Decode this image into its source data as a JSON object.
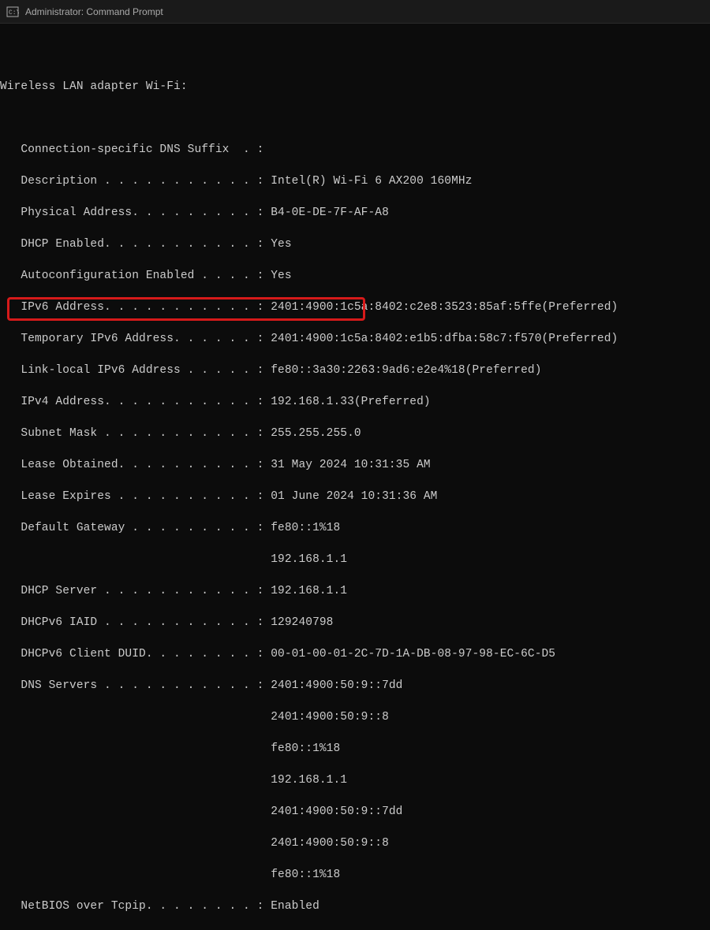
{
  "window": {
    "title": "Administrator: Command Prompt"
  },
  "terminal": {
    "lines": [
      "",
      "Wireless LAN adapter Wi-Fi:",
      "",
      "   Connection-specific DNS Suffix  . :",
      "   Description . . . . . . . . . . . : Intel(R) Wi-Fi 6 AX200 160MHz",
      "   Physical Address. . . . . . . . . : B4-0E-DE-7F-AF-A8",
      "   DHCP Enabled. . . . . . . . . . . : Yes",
      "   Autoconfiguration Enabled . . . . : Yes",
      "   IPv6 Address. . . . . . . . . . . : 2401:4900:1c5a:8402:c2e8:3523:85af:5ffe(Preferred)",
      "   Temporary IPv6 Address. . . . . . : 2401:4900:1c5a:8402:e1b5:dfba:58c7:f570(Preferred)",
      "   Link-local IPv6 Address . . . . . : fe80::3a30:2263:9ad6:e2e4%18(Preferred)",
      "   IPv4 Address. . . . . . . . . . . : 192.168.1.33(Preferred)",
      "   Subnet Mask . . . . . . . . . . . : 255.255.255.0",
      "   Lease Obtained. . . . . . . . . . : 31 May 2024 10:31:35 AM",
      "   Lease Expires . . . . . . . . . . : 01 June 2024 10:31:36 AM",
      "   Default Gateway . . . . . . . . . : fe80::1%18",
      "                                       192.168.1.1",
      "   DHCP Server . . . . . . . . . . . : 192.168.1.1",
      "   DHCPv6 IAID . . . . . . . . . . . : 129240798",
      "   DHCPv6 Client DUID. . . . . . . . : 00-01-00-01-2C-7D-1A-DB-08-97-98-EC-6C-D5",
      "   DNS Servers . . . . . . . . . . . : 2401:4900:50:9::7dd",
      "                                       2401:4900:50:9::8",
      "                                       fe80::1%18",
      "                                       192.168.1.1",
      "                                       2401:4900:50:9::7dd",
      "                                       2401:4900:50:9::8",
      "                                       fe80::1%18",
      "   NetBIOS over Tcpip. . . . . . . . : Enabled"
    ]
  }
}
